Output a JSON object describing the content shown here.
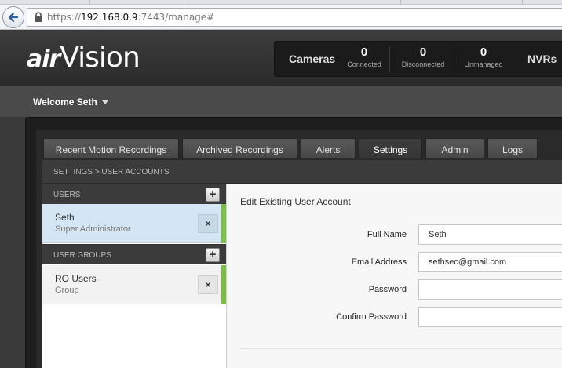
{
  "browser": {
    "url_prefix": "https://",
    "url_host": "192.168.0.9",
    "url_rest": ":7443/manage#"
  },
  "app": {
    "logo_air": "air",
    "logo_vision": "Vision",
    "welcome": "Welcome Seth"
  },
  "stats": {
    "cameras_label": "Cameras",
    "nvrs_label": "NVRs",
    "items": [
      {
        "num": "0",
        "label": "Connected"
      },
      {
        "num": "0",
        "label": "Disconnected"
      },
      {
        "num": "0",
        "label": "Unmanaged"
      }
    ]
  },
  "tabs": [
    {
      "label": "Recent Motion Recordings"
    },
    {
      "label": "Archived Recordings"
    },
    {
      "label": "Alerts"
    },
    {
      "label": "Settings"
    },
    {
      "label": "Admin"
    },
    {
      "label": "Logs"
    }
  ],
  "breadcrumb": "SETTINGS > USER ACCOUNTS",
  "users_section": {
    "title": "USERS",
    "plus": "+",
    "items": [
      {
        "name": "Seth",
        "sub": "Super Administrator",
        "remove": "×"
      }
    ]
  },
  "groups_section": {
    "title": "USER GROUPS",
    "plus": "+",
    "items": [
      {
        "name": "RO Users",
        "sub": "Group",
        "remove": "×"
      }
    ]
  },
  "form": {
    "title": "Edit Existing User Account",
    "full_name_label": "Full Name",
    "full_name_value": "Seth",
    "email_label": "Email Address",
    "email_value": "sethsec@gmail.com",
    "password_label": "Password",
    "password_value": "",
    "confirm_label": "Confirm Password",
    "confirm_value": ""
  },
  "colors": {
    "accent_green": "#7ac143",
    "selected_row": "#d4e6f3",
    "header_dark": "#2b2b2b"
  }
}
